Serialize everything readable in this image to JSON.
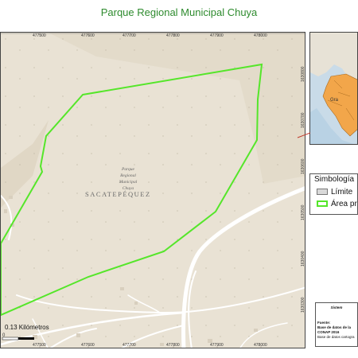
{
  "title": "Parque Regional Municipal Chuya",
  "map": {
    "region_label": "SACATEPÉQUEZ",
    "park_label_lines": [
      "Parque",
      "Regional",
      "Municipal",
      "Chuya"
    ],
    "top_ticks": [
      "477500",
      "477600",
      "477700",
      "477800",
      "477900",
      "478000"
    ],
    "bottom_ticks": [
      "477500",
      "477600",
      "477700",
      "477800",
      "477900",
      "478000"
    ],
    "right_ticks": [
      "1630800",
      "1630700",
      "1630600",
      "1630500",
      "1630400",
      "1630300"
    ],
    "scale_label": "0.13 Kilómetros",
    "scale_zero": "0",
    "colors": {
      "park_outline": "#55e62a",
      "terrain": "#e9e2d4",
      "road": "#ffffff"
    }
  },
  "inset": {
    "label_fragment": "Gra"
  },
  "legend": {
    "title": "Simbología",
    "items": [
      {
        "label": "Límite",
        "swatch": "#d9d9d9",
        "border": "#777777"
      },
      {
        "label": "Área pr",
        "swatch": "#ffffff",
        "border": "#55e62a"
      }
    ]
  },
  "info": {
    "header": "Sistem",
    "lines": [
      "Fuente:",
      "Base de datos de la",
      "CONAP 2016",
      "Base de datos cartogra"
    ]
  }
}
